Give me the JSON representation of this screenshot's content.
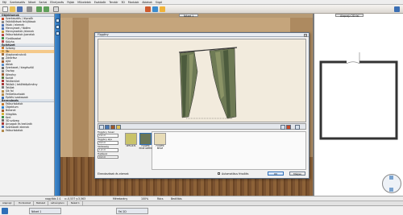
{
  "app": {
    "title": "Szerkesztő"
  },
  "menu": [
    "Fájl",
    "Szerkesztés",
    "Nézet",
    "Sarkai",
    "Elhelyezés",
    "Fájlok",
    "Műveletek",
    "Eszközök",
    "Tervtár",
    "3D",
    "Modulok",
    "Ablakok",
    "Súgó"
  ],
  "sidebar": {
    "section1": "Objektumok",
    "items1": [
      {
        "label": "Szerkesztés / lépcsők",
        "color": "#c94b2a"
      },
      {
        "label": "Falkitöltések felújítások",
        "color": "#8a8a8a"
      },
      {
        "label": "Falak / elemek",
        "color": "#4f73b4"
      },
      {
        "label": "Mennyezet / födém",
        "color": "#4f73b4"
      },
      {
        "label": "Mennyezetek /elemek",
        "color": "#c49a3c"
      },
      {
        "label": "Falburkolatok /panelok",
        "color": "#b64b4b"
      },
      {
        "label": "Fürdőszobai",
        "color": "#3f8f4a"
      },
      {
        "label": "Kályha",
        "color": "#b64b4b"
      }
    ],
    "section2": "Építészet",
    "items2": [
      {
        "label": "Szöveg",
        "color": "#cf7a2e"
      },
      {
        "label": "Tér",
        "color": "#d39c3b",
        "selected": true
      },
      {
        "label": "Alapkonstrukció",
        "color": "#9c6b3d"
      },
      {
        "label": "Zárórész",
        "color": "#7f7f7f"
      },
      {
        "label": "Ajtó",
        "color": "#9e5b2e"
      },
      {
        "label": "Ablak",
        "color": "#5b8ec9"
      },
      {
        "label": "Szerkezet / kiegészítő",
        "color": "#6b6b6b"
      },
      {
        "label": "Oszlop",
        "color": "#8d8d8d"
      },
      {
        "label": "Kémény",
        "color": "#a05a2c"
      },
      {
        "label": "Korlát",
        "color": "#5a7a3a"
      },
      {
        "label": "Tetőterület",
        "color": "#a83a3a"
      },
      {
        "label": "Tetősík / tetőfelépítmény",
        "color": "#a83a3a"
      },
      {
        "label": "Tetőlet",
        "color": "#7a7a7a"
      },
      {
        "label": "Sík fal",
        "color": "#b38b4d"
      },
      {
        "label": "Felületburkolat",
        "color": "#b38b4d"
      },
      {
        "label": "Építési szakaszok",
        "color": "#3b6fb4"
      }
    ],
    "section3": "Berendezés",
    "items3": [
      {
        "label": "Falburkolatok",
        "color": "#c47a2e"
      },
      {
        "label": "Objektum",
        "color": "#2f7fc8"
      },
      {
        "label": "Bútorok",
        "color": "#a05a2c"
      },
      {
        "label": "Világítás",
        "color": "#d7b53b"
      },
      {
        "label": "Kert",
        "color": "#3f8f4a"
      },
      {
        "label": "3D szöveg",
        "color": "#6b6b6b"
      },
      {
        "label": "Anyagok és textúrák",
        "color": "#a83a3a"
      },
      {
        "label": "Szerkezeti elemek",
        "color": "#4f73b4"
      },
      {
        "label": "Falburkolatok",
        "color": "#b38b4d"
      }
    ]
  },
  "view3d": {
    "tab": "Nézet 1"
  },
  "view2d": {
    "tab": "Alaprajz 2D fal"
  },
  "dialog": {
    "title": "Függöny",
    "params": [
      {
        "label": "Függöny hossz",
        "value": "2,4 m"
      },
      {
        "label": "Függöny alja",
        "value": "0,0 m"
      },
      {
        "label": "Szélesség",
        "value": "1,4 m"
      },
      {
        "label": "Hajtások",
        "value": "0,0 m"
      }
    ],
    "swatches": [
      {
        "label": "DEFAULT4",
        "color": "#c9c36a"
      },
      {
        "label": "FLOWER EDGE GREEN",
        "color": "#6a7758"
      },
      {
        "label": "FLOWER BEIGE",
        "color": "#e8dcb7"
      }
    ],
    "section_label": "Elrendezések és elemek",
    "checkbox_label": "Automatikus frissítés",
    "ok": "OK",
    "cancel": "Mégse"
  },
  "status": {
    "left": "nagyítás 1:1",
    "coords": "x:-0,537 y:3,563",
    "scale": "Méretarány",
    "zoom": "100%",
    "snap": "Rács",
    "mode": "Beállítás"
  },
  "tabs": [
    "Alaprajz",
    "Homlokzat",
    "Metszet",
    "Látványterv",
    "Nézet 1"
  ],
  "taskbar": {
    "item1": "Nézet 1",
    "item2": "Fal 2D"
  }
}
